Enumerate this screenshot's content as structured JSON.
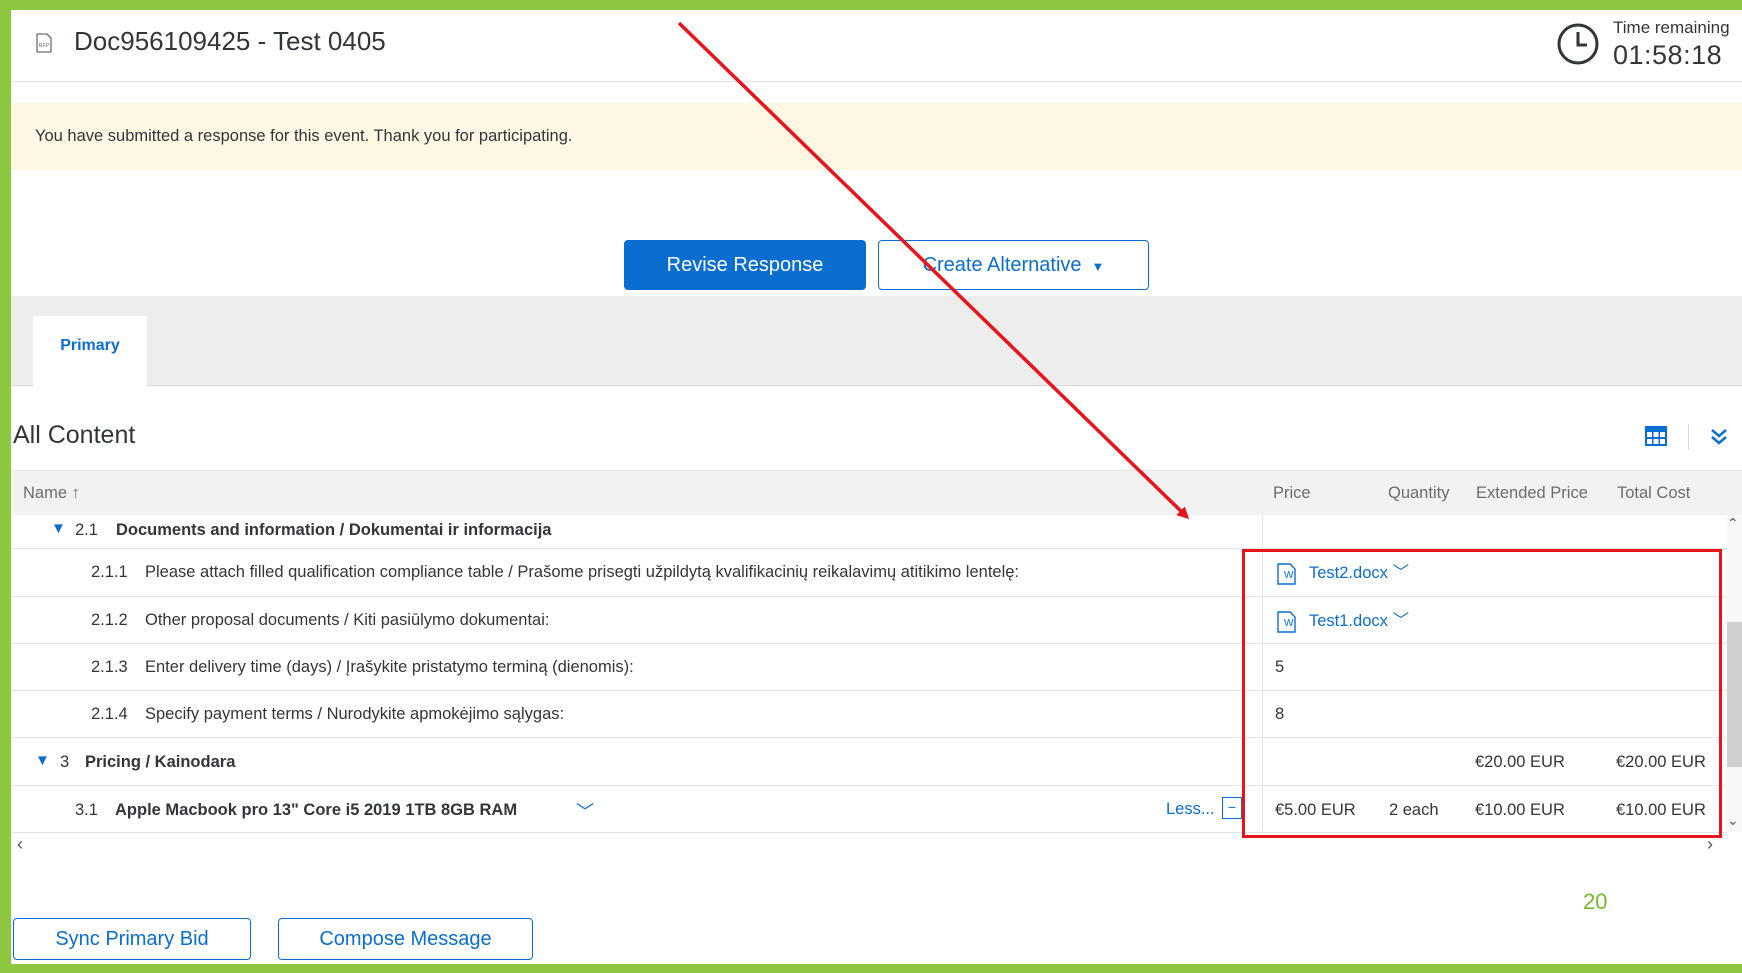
{
  "header": {
    "doc_title": "Doc956109425 - Test 0405",
    "timer_label": "Time remaining",
    "timer_value": "01:58:18"
  },
  "banner": {
    "message": "You have submitted a response for this event.  Thank you for participating."
  },
  "actions": {
    "revise_label": "Revise Response",
    "create_alt_label": "Create Alternative"
  },
  "tabs": [
    {
      "label": "Primary"
    }
  ],
  "content": {
    "title": "All Content",
    "columns": {
      "name": "Name",
      "price": "Price",
      "quantity": "Quantity",
      "extended_price": "Extended Price",
      "total_cost": "Total Cost"
    },
    "rows": [
      {
        "num": "2.1",
        "name": "Documents and information / Dokumentai ir informacija"
      },
      {
        "num": "2.1.1",
        "name": "Please attach filled qualification compliance table / Prašome prisegti užpildytą kvalifikacinių reikalavimų atitikimo lentelę:",
        "price": "Test2.docx"
      },
      {
        "num": "2.1.2",
        "name": "Other proposal documents / Kiti pasiūlymo dokumentai:",
        "price": "Test1.docx"
      },
      {
        "num": "2.1.3",
        "name": "Enter delivery time (days) / Įrašykite pristatymo terminą (dienomis):",
        "price": "5"
      },
      {
        "num": "2.1.4",
        "name": "Specify payment terms / Nurodykite apmokėjimo sąlygas:",
        "price": "8"
      },
      {
        "num": "3",
        "name": "Pricing / Kainodara",
        "extended_price": "€20.00 EUR",
        "total_cost": "€20.00 EUR"
      },
      {
        "num": "3.1",
        "name": "Apple Macbook pro 13\" Core i5 2019 1TB 8GB RAM",
        "less": "Less...",
        "price": "€5.00 EUR",
        "quantity": "2 each",
        "extended_price": "€10.00 EUR",
        "total_cost": "€10.00 EUR"
      }
    ]
  },
  "footer": {
    "sync_label": "Sync Primary Bid",
    "compose_label": "Compose Message",
    "page_number": "20"
  },
  "colors": {
    "brand_blue": "#0a6ed1",
    "frame_green": "#8dc63f",
    "banner_bg": "#fdf7e3",
    "annotation_red": "#e8141c"
  },
  "icons": [
    "rfp-document-icon",
    "clock-icon",
    "table-settings-icon",
    "expand-all-icon",
    "word-file-icon",
    "chevron-down-icon"
  ]
}
